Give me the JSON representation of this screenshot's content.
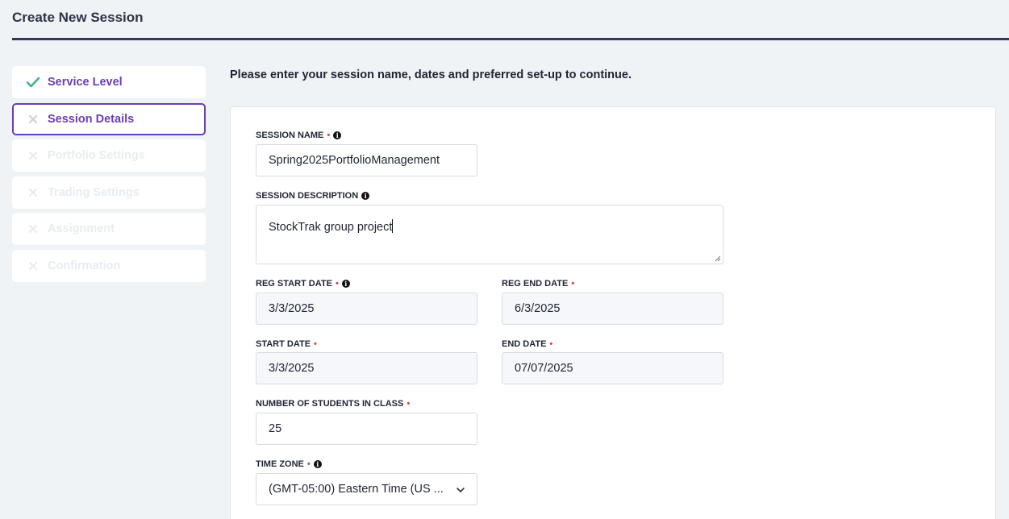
{
  "page": {
    "title": "Create New Session"
  },
  "steps": [
    {
      "label": "Service Level",
      "status": "done"
    },
    {
      "label": "Session Details",
      "status": "active"
    },
    {
      "label": "Portfolio Settings",
      "status": "todo"
    },
    {
      "label": "Trading Settings",
      "status": "todo"
    },
    {
      "label": "Assignment",
      "status": "todo"
    },
    {
      "label": "Confirmation",
      "status": "todo"
    }
  ],
  "instructions": "Please enter your session name, dates and preferred set-up to continue.",
  "form": {
    "session_name": {
      "label": "SESSION NAME",
      "value": "Spring2025PortfolioManagement"
    },
    "session_description": {
      "label": "SESSION DESCRIPTION",
      "value": "StockTrak group project"
    },
    "reg_start_date": {
      "label": "REG START DATE",
      "value": "3/3/2025"
    },
    "reg_end_date": {
      "label": "REG END DATE",
      "value": "6/3/2025"
    },
    "start_date": {
      "label": "START DATE",
      "value": "3/3/2025"
    },
    "end_date": {
      "label": "END DATE",
      "value": "07/07/2025"
    },
    "num_students": {
      "label": "NUMBER OF STUDENTS IN CLASS",
      "value": "25"
    },
    "time_zone": {
      "label": "TIME ZONE",
      "value": "(GMT-05:00) Eastern Time (US ..."
    }
  },
  "required_marker": "•",
  "info_marker": "i",
  "colors": {
    "accent": "#6a3fb4",
    "check": "#3fb58a",
    "required": "#e0453e",
    "header_rule": "#363756"
  }
}
